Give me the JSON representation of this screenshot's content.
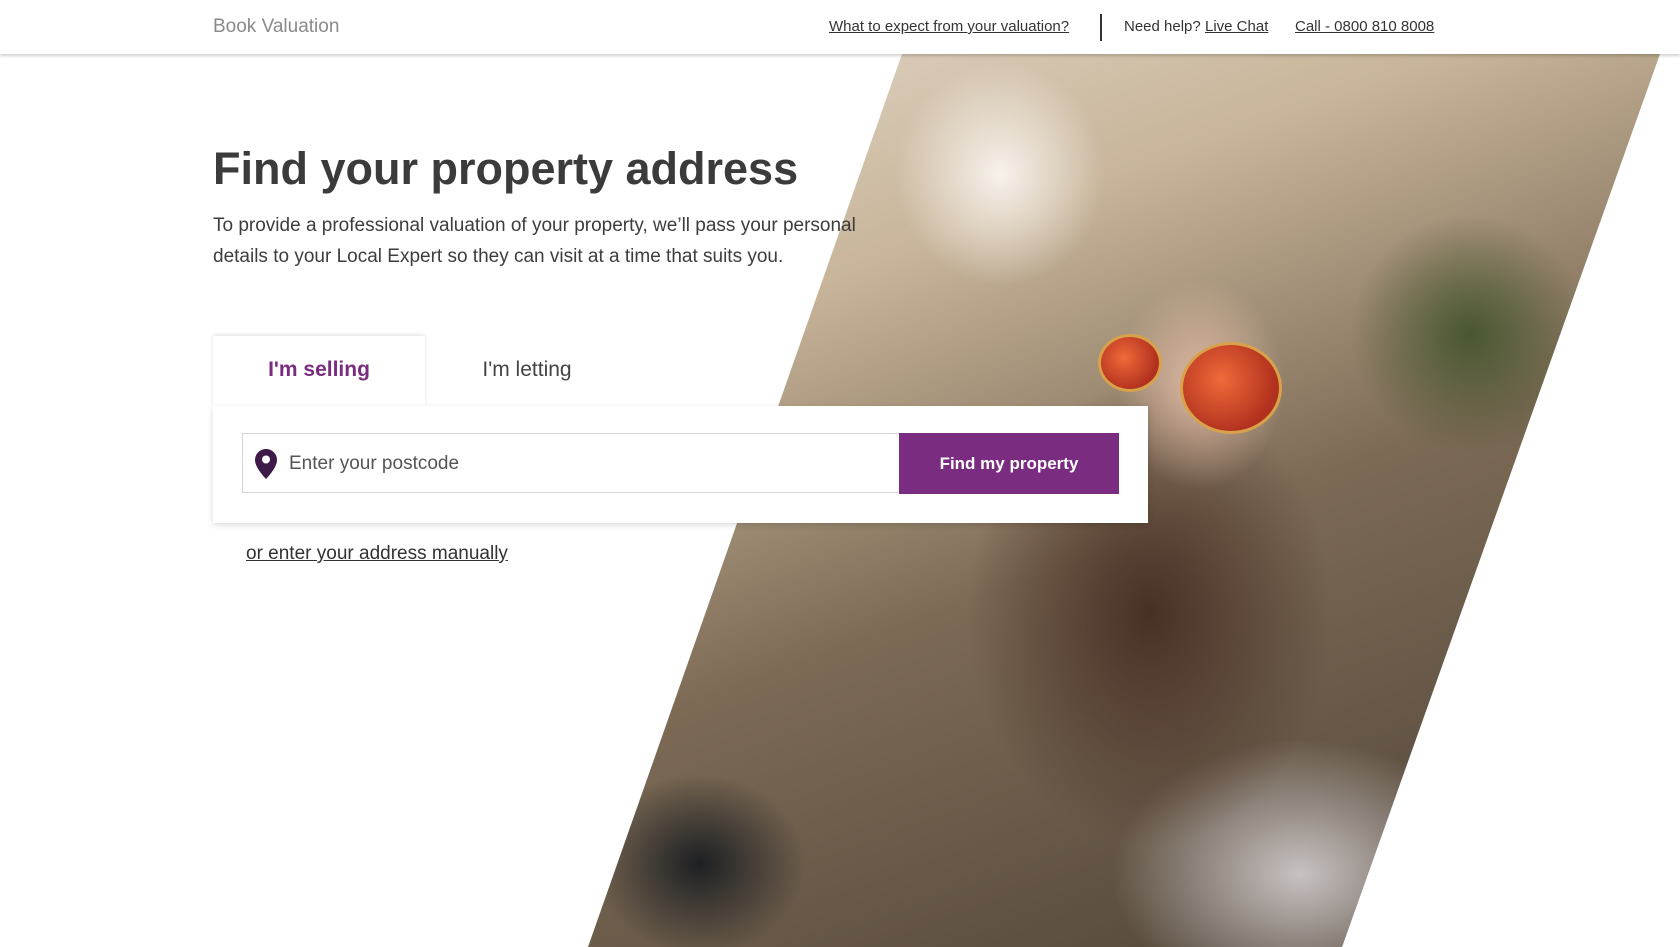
{
  "header": {
    "brand": "Book Valuation",
    "expect_link": "What to expect from your valuation?",
    "help_text": "Need help?",
    "live_chat": "Live Chat",
    "call": "Call - 0800 810 8008"
  },
  "hero": {
    "title": "Find your property address",
    "subtitle": "To provide a professional valuation of your property, we’ll pass your personal details to your Local Expert so they can visit at a time that suits you."
  },
  "tabs": [
    {
      "label": "I'm selling",
      "active": true
    },
    {
      "label": "I'm letting",
      "active": false
    }
  ],
  "search": {
    "placeholder": "Enter your postcode",
    "value": "",
    "icon": "location-pin-icon",
    "button_label": "Find my property"
  },
  "manual_link": "or enter your address manually",
  "colors": {
    "accent": "#7a2c80",
    "text": "#333333",
    "brand_gray": "#8a8a8a"
  }
}
